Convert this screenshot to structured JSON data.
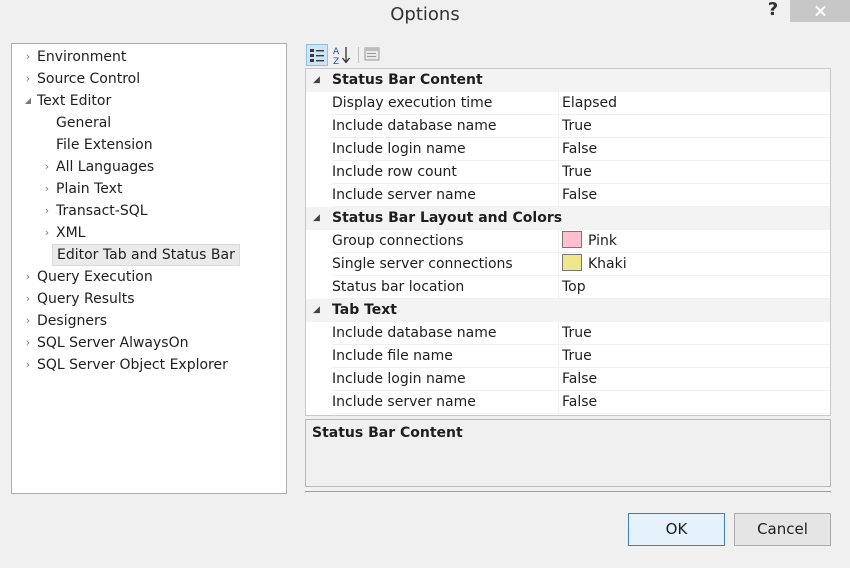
{
  "window": {
    "title": "Options",
    "help_label": "?"
  },
  "tree": [
    {
      "label": "Environment",
      "arrow": "›",
      "level": 0
    },
    {
      "label": "Source Control",
      "arrow": "›",
      "level": 0
    },
    {
      "label": "Text Editor",
      "arrow": "◢",
      "level": 0
    },
    {
      "label": "General",
      "arrow": "",
      "level": 1
    },
    {
      "label": "File Extension",
      "arrow": "",
      "level": 1
    },
    {
      "label": "All Languages",
      "arrow": "›",
      "level": 1
    },
    {
      "label": "Plain Text",
      "arrow": "›",
      "level": 1
    },
    {
      "label": "Transact-SQL",
      "arrow": "›",
      "level": 1
    },
    {
      "label": "XML",
      "arrow": "›",
      "level": 1
    },
    {
      "label": "Editor Tab and Status Bar",
      "arrow": "",
      "level": 1,
      "selected": true
    },
    {
      "label": "Query Execution",
      "arrow": "›",
      "level": 0
    },
    {
      "label": "Query Results",
      "arrow": "›",
      "level": 0
    },
    {
      "label": "Designers",
      "arrow": "›",
      "level": 0
    },
    {
      "label": "SQL Server AlwaysOn",
      "arrow": "›",
      "level": 0
    },
    {
      "label": "SQL Server Object Explorer",
      "arrow": "›",
      "level": 0
    }
  ],
  "toolbar": {
    "categorized_icon": "categorized-icon",
    "alphabetical_icon": "sort-az-icon",
    "property_pages_icon": "property-pages-icon"
  },
  "grid": [
    {
      "type": "category",
      "label": "Status Bar Content",
      "collapse": "◢"
    },
    {
      "type": "property",
      "name": "Display execution time",
      "value": "Elapsed"
    },
    {
      "type": "property",
      "name": "Include database name",
      "value": "True"
    },
    {
      "type": "property",
      "name": "Include login name",
      "value": "False"
    },
    {
      "type": "property",
      "name": "Include row count",
      "value": "True"
    },
    {
      "type": "property",
      "name": "Include server name",
      "value": "False"
    },
    {
      "type": "category",
      "label": "Status Bar Layout and Colors",
      "collapse": "◢"
    },
    {
      "type": "property",
      "name": "Group connections",
      "value": "Pink",
      "swatch": "#ffc0cb"
    },
    {
      "type": "property",
      "name": "Single server connections",
      "value": "Khaki",
      "swatch": "#f0e68c"
    },
    {
      "type": "property",
      "name": "Status bar location",
      "value": "Top"
    },
    {
      "type": "category",
      "label": "Tab Text",
      "collapse": "◢"
    },
    {
      "type": "property",
      "name": "Include database name",
      "value": "True"
    },
    {
      "type": "property",
      "name": "Include file name",
      "value": "True"
    },
    {
      "type": "property",
      "name": "Include login name",
      "value": "False"
    },
    {
      "type": "property",
      "name": "Include server name",
      "value": "False"
    }
  ],
  "description": {
    "title": "Status Bar Content"
  },
  "buttons": {
    "ok": "OK",
    "cancel": "Cancel"
  }
}
